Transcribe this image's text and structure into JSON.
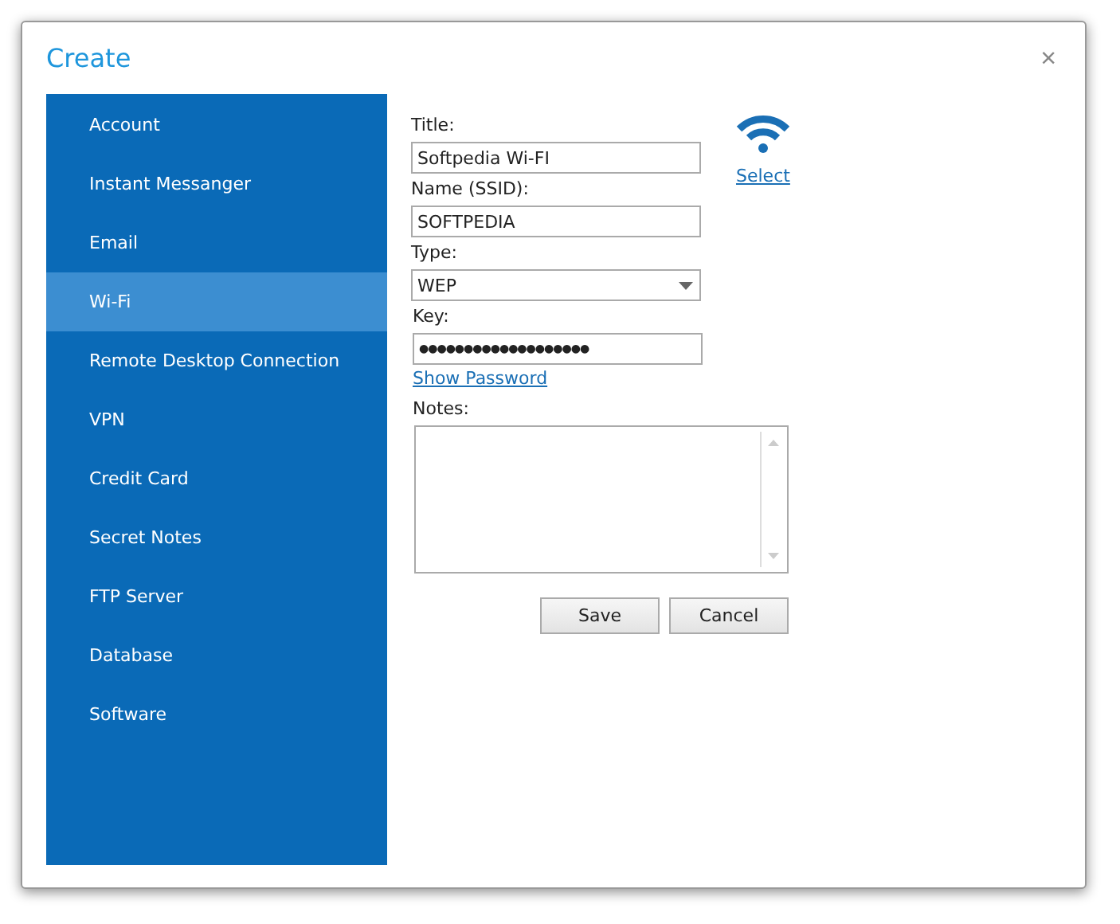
{
  "window": {
    "title": "Create",
    "close": "×"
  },
  "sidebar": {
    "items": [
      {
        "label": "Account",
        "selected": false
      },
      {
        "label": "Instant Messanger",
        "selected": false
      },
      {
        "label": "Email",
        "selected": false
      },
      {
        "label": "Wi-Fi",
        "selected": true
      },
      {
        "label": "Remote Desktop Connection",
        "selected": false
      },
      {
        "label": "VPN",
        "selected": false
      },
      {
        "label": "Credit Card",
        "selected": false
      },
      {
        "label": "Secret Notes",
        "selected": false
      },
      {
        "label": "FTP Server",
        "selected": false
      },
      {
        "label": "Database",
        "selected": false
      },
      {
        "label": "Software",
        "selected": false
      }
    ]
  },
  "form": {
    "title_label": "Title:",
    "title_value": "Softpedia Wi-FI",
    "name_label": "Name (SSID):",
    "name_value": "SOFTPEDIA",
    "type_label": "Type:",
    "type_value": "WEP",
    "key_label": "Key:",
    "key_value": "●●●●●●●●●●●●●●●●●●●",
    "show_password": "Show Password",
    "notes_label": "Notes:",
    "icon_link": "Select"
  },
  "buttons": [
    "Save",
    "Cancel"
  ]
}
